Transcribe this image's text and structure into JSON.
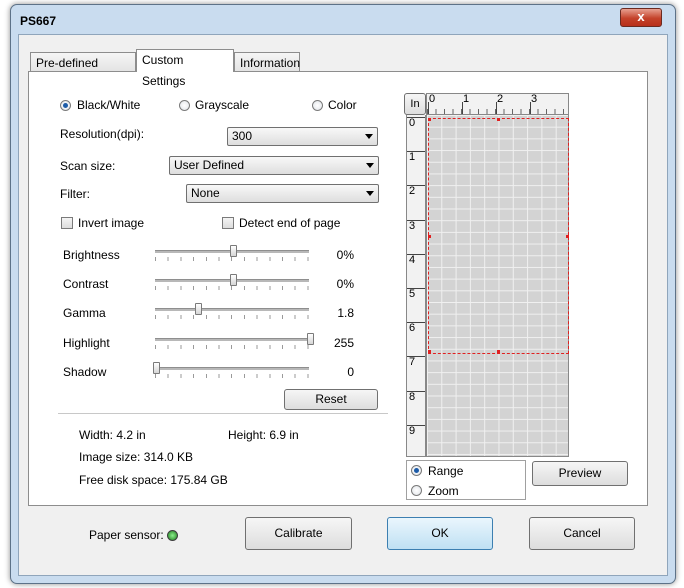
{
  "window": {
    "title": "PS667",
    "close_glyph": "x"
  },
  "tabs": [
    {
      "label": "Pre-defined Setting",
      "active": false
    },
    {
      "label": "Custom Settings",
      "active": true
    },
    {
      "label": "Information",
      "active": false
    }
  ],
  "color_mode": {
    "options": [
      "Black/White",
      "Grayscale",
      "Color"
    ],
    "selected": "Black/White"
  },
  "fields": {
    "resolution": {
      "label": "Resolution(dpi):",
      "value": "300"
    },
    "scan_size": {
      "label": "Scan size:",
      "value": "User Defined"
    },
    "filter": {
      "label": "Filter:",
      "value": "None"
    }
  },
  "checkboxes": {
    "invert": {
      "label": "Invert image",
      "checked": false
    },
    "detect_end": {
      "label": "Detect end of page",
      "checked": false
    }
  },
  "sliders": [
    {
      "label": "Brightness",
      "value": "0%",
      "position": 0.5
    },
    {
      "label": "Contrast",
      "value": "0%",
      "position": 0.5
    },
    {
      "label": "Gamma",
      "value": "1.8",
      "position": 0.27
    },
    {
      "label": "Highlight",
      "value": "255",
      "position": 1.0
    },
    {
      "label": "Shadow",
      "value": "0",
      "position": 0.0
    }
  ],
  "reset_label": "Reset",
  "info": {
    "width": "Width: 4.2 in",
    "height": "Height: 6.9 in",
    "image_size": "Image size: 314.0 KB",
    "free_disk": "Free disk space: 175.84 GB"
  },
  "preview": {
    "unit_button": "In",
    "ruler_h": [
      "0",
      "1",
      "2",
      "3"
    ],
    "ruler_v": [
      "0",
      "1",
      "2",
      "3",
      "4",
      "5",
      "6",
      "7",
      "8",
      "9"
    ],
    "mode_options": [
      "Range",
      "Zoom"
    ],
    "mode_selected": "Range",
    "preview_label": "Preview"
  },
  "footer": {
    "paper_sensor_label": "Paper sensor:",
    "calibrate_label": "Calibrate",
    "ok_label": "OK",
    "cancel_label": "Cancel"
  },
  "colors": {
    "selection": "#e02020",
    "sensor_led": "#2ea82e",
    "frame": "#c9dcef"
  }
}
